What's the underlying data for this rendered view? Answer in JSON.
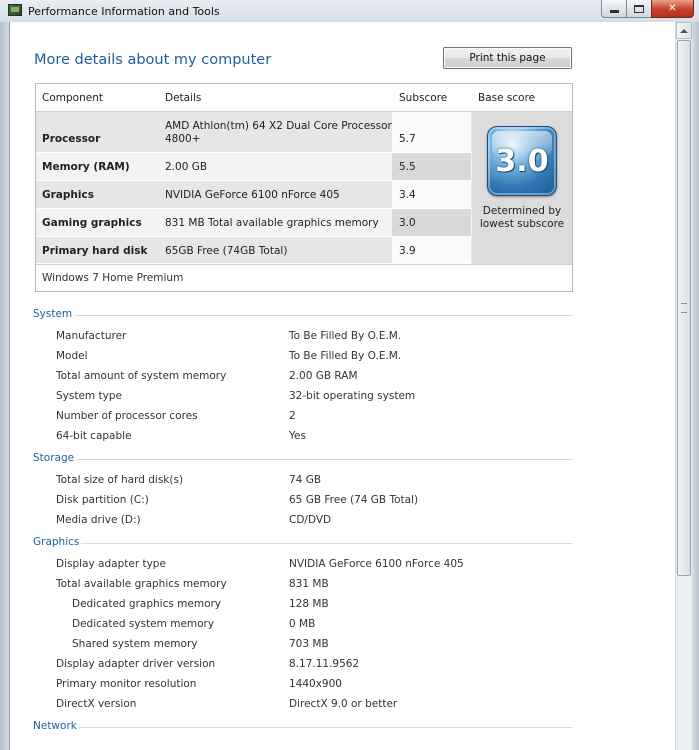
{
  "window": {
    "title": "Performance Information and Tools"
  },
  "page": {
    "title": "More details about my computer",
    "print_button": "Print this page"
  },
  "score_table": {
    "headers": [
      "Component",
      "Details",
      "Subscore",
      "Base score"
    ],
    "rows": [
      {
        "component": "Processor",
        "details_line1": "AMD Athlon(tm) 64 X2 Dual Core Processor",
        "details_line2": "4800+",
        "subscore": "5.7"
      },
      {
        "component": "Memory (RAM)",
        "details_line1": "2.00 GB",
        "details_line2": "",
        "subscore": "5.5"
      },
      {
        "component": "Graphics",
        "details_line1": "NVIDIA GeForce 6100 nForce 405",
        "details_line2": "",
        "subscore": "3.4"
      },
      {
        "component": "Gaming graphics",
        "details_line1": "831 MB Total available graphics memory",
        "details_line2": "",
        "subscore": "3.0"
      },
      {
        "component": "Primary hard disk",
        "details_line1": "65GB Free (74GB Total)",
        "details_line2": "",
        "subscore": "3.9"
      }
    ],
    "base_score": "3.0",
    "base_caption_line1": "Determined by",
    "base_caption_line2": "lowest subscore",
    "edition": "Windows 7 Home Premium"
  },
  "sections": {
    "system": {
      "title": "System",
      "items": [
        {
          "label": "Manufacturer",
          "value": "To Be Filled By O.E.M."
        },
        {
          "label": "Model",
          "value": "To Be Filled By O.E.M."
        },
        {
          "label": "Total amount of system memory",
          "value": "2.00 GB RAM"
        },
        {
          "label": "System type",
          "value": "32-bit operating system"
        },
        {
          "label": "Number of processor cores",
          "value": "2"
        },
        {
          "label": "64-bit capable",
          "value": "Yes"
        }
      ]
    },
    "storage": {
      "title": "Storage",
      "items": [
        {
          "label": "Total size of hard disk(s)",
          "value": "74 GB"
        },
        {
          "label": "Disk partition (C:)",
          "value": "65 GB Free (74 GB Total)"
        },
        {
          "label": "Media drive (D:)",
          "value": "CD/DVD"
        }
      ]
    },
    "graphics": {
      "title": "Graphics",
      "items": [
        {
          "label": "Display adapter type",
          "value": "NVIDIA GeForce 6100 nForce 405"
        },
        {
          "label": "Total available graphics memory",
          "value": "831 MB"
        },
        {
          "label": "Dedicated graphics memory",
          "value": "128 MB"
        },
        {
          "label": "Dedicated system memory",
          "value": "0 MB"
        },
        {
          "label": "Shared system memory",
          "value": "703 MB"
        },
        {
          "label": "Display adapter driver version",
          "value": "8.17.11.9562"
        },
        {
          "label": "Primary monitor resolution",
          "value": "1440x900"
        },
        {
          "label": "DirectX version",
          "value": "DirectX 9.0 or better"
        }
      ]
    },
    "network": {
      "title": "Network"
    }
  }
}
